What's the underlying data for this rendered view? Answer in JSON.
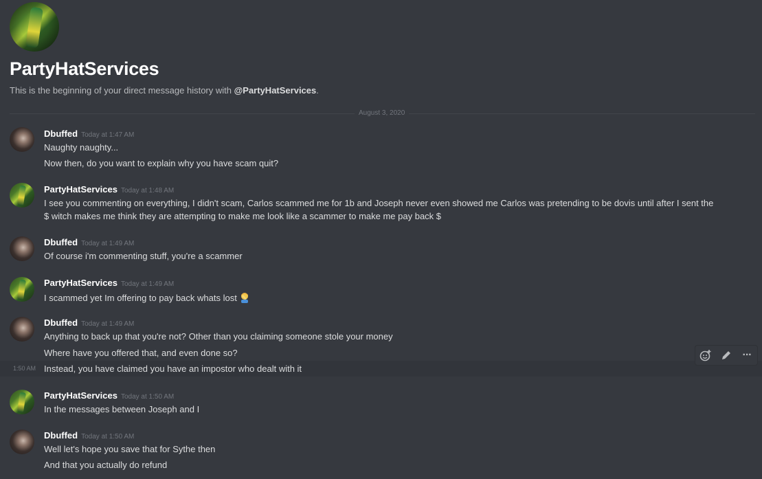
{
  "header": {
    "title": "PartyHatServices",
    "subtitle_prefix": "This is the beginning of your direct message history with ",
    "subtitle_handle": "@PartyHatServices",
    "subtitle_suffix": "."
  },
  "divider": {
    "date": "August 3, 2020"
  },
  "messages": [
    {
      "author": "Dbuffed",
      "time": "Today at 1:47 AM",
      "lines": [
        "Naughty naughty...",
        "Now then, do you want to explain why you have scam quit?"
      ]
    },
    {
      "author": "PartyHatServices",
      "time": "Today at 1:48 AM",
      "lines": [
        "I see you commenting on everything, I didn't scam, Carlos scammed me for 1b and Joseph never even showed me Carlos was pretending to be dovis until after I sent the",
        "$ witch makes me think they are attempting to make me look like a scammer to make me pay back $"
      ]
    },
    {
      "author": "Dbuffed",
      "time": "Today at 1:49 AM",
      "lines": [
        "Of course i'm commenting stuff, you're a scammer"
      ]
    },
    {
      "author": "PartyHatServices",
      "time": "Today at 1:49 AM",
      "lines": [
        "I scammed yet Im offering to pay back whats lost"
      ],
      "emoji": "man-facepalming-emoji"
    },
    {
      "author": "Dbuffed",
      "time": "Today at 1:49 AM",
      "lines": [
        "Anything to back up that you're not? Other than you claiming someone stole your money",
        "Where have you offered that, and even done so?"
      ]
    },
    {
      "hover_time": "1:50 AM",
      "lines": [
        "Instead, you have claimed you have an impostor who dealt with it"
      ]
    },
    {
      "author": "PartyHatServices",
      "time": "Today at 1:50 AM",
      "lines": [
        "In the messages between Joseph and I"
      ]
    },
    {
      "author": "Dbuffed",
      "time": "Today at 1:50 AM",
      "lines": [
        "Well let's hope you save that for Sythe then",
        "And that you actually do refund"
      ]
    }
  ],
  "toolbar": {
    "icons": [
      "add-reaction-icon",
      "edit-icon",
      "more-options-icon"
    ],
    "more_label": "···"
  },
  "colors": {
    "background": "#36393f",
    "hover_background": "#32353b",
    "text": "#dcddde",
    "muted": "#72767d",
    "author": "#ffffff"
  }
}
